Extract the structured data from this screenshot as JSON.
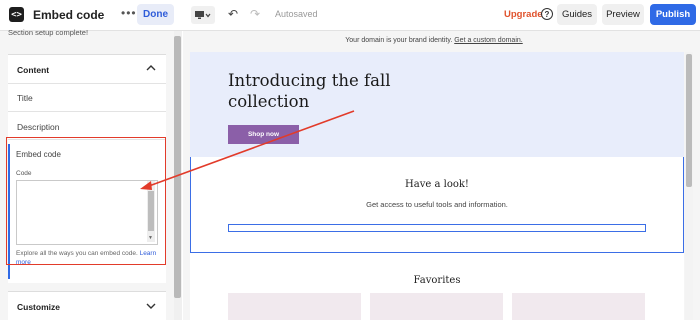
{
  "topbar": {
    "app_icon_glyph": "<>",
    "app_title": "Embed code",
    "more_glyph": "•••",
    "done_label": "Done",
    "undo_glyph": "↶",
    "redo_glyph": "↷",
    "autosaved_text": "Autosaved",
    "upgrade_label": "Upgrade",
    "help_glyph": "?",
    "guides_label": "Guides",
    "preview_label": "Preview",
    "publish_label": "Publish"
  },
  "left_panel": {
    "status_text": "Section setup complete!",
    "content_section": {
      "heading": "Content",
      "items": {
        "title": "Title",
        "description": "Description",
        "embed_code": "Embed code"
      }
    },
    "code_field": {
      "label": "Code",
      "value": ""
    },
    "hint_text": "Explore all the ways you can embed code.",
    "hint_link": "Learn more",
    "customize_heading": "Customize"
  },
  "canvas": {
    "domain_banner_text": "Your domain is your brand identity.",
    "domain_banner_link": "Get a custom domain.",
    "hero_title": "Introducing the fall collection",
    "hero_button": "Shop now",
    "look_title": "Have a look!",
    "look_subtitle": "Get access to useful tools and information.",
    "favorites_title": "Favorites"
  },
  "colors": {
    "accent_blue": "#2f6ae6",
    "upgrade_orange": "#e0522c",
    "annotation_red": "#e23b2a",
    "hero_bg": "#e8edfb",
    "shop_button": "#8b5fa8",
    "favorite_card": "#f1e9ee"
  }
}
